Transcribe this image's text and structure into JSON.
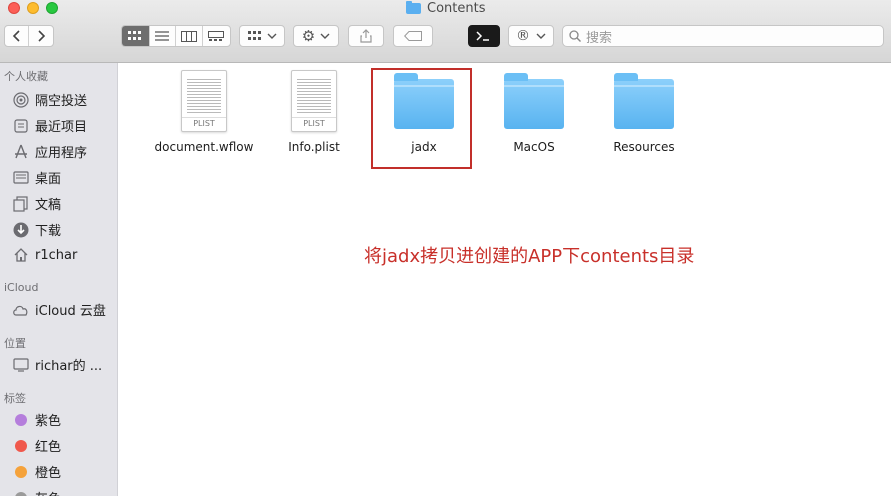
{
  "window": {
    "title": "Contents"
  },
  "toolbar": {
    "view_modes": [
      "icon-view",
      "list-view",
      "column-view",
      "gallery-view"
    ],
    "active_view": "icon-view",
    "search_placeholder": "搜索"
  },
  "sidebar": {
    "sections": [
      {
        "header": "个人收藏",
        "items": [
          {
            "label": "隔空投送",
            "icon": "airdrop-icon"
          },
          {
            "label": "最近项目",
            "icon": "recent-icon"
          },
          {
            "label": "应用程序",
            "icon": "applications-icon"
          },
          {
            "label": "桌面",
            "icon": "desktop-icon"
          },
          {
            "label": "文稿",
            "icon": "documents-icon"
          },
          {
            "label": "下载",
            "icon": "downloads-icon"
          },
          {
            "label": "r1char",
            "icon": "home-icon"
          }
        ]
      },
      {
        "header": "iCloud",
        "items": [
          {
            "label": "iCloud 云盘",
            "icon": "cloud-icon"
          }
        ]
      },
      {
        "header": "位置",
        "items": [
          {
            "label": "richar的 ...",
            "icon": "computer-icon"
          }
        ]
      },
      {
        "header": "标签",
        "items": [
          {
            "label": "紫色",
            "color": "#b57edc"
          },
          {
            "label": "红色",
            "color": "#f0584c"
          },
          {
            "label": "橙色",
            "color": "#f5a23b"
          },
          {
            "label": "灰色",
            "color": "#9a9a9a"
          }
        ]
      }
    ]
  },
  "files": [
    {
      "name": "document.wflow",
      "kind": "plist",
      "badge": "PLIST"
    },
    {
      "name": "Info.plist",
      "kind": "plist",
      "badge": "PLIST"
    },
    {
      "name": "jadx",
      "kind": "folder",
      "highlighted": true
    },
    {
      "name": "MacOS",
      "kind": "folder"
    },
    {
      "name": "Resources",
      "kind": "folder"
    }
  ],
  "annotation": {
    "text": "将jadx拷贝进创建的APP下contents目录",
    "color": "#c8302a"
  }
}
